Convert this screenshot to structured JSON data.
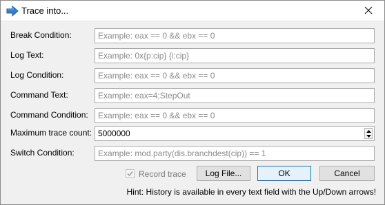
{
  "window": {
    "title": "Trace into...",
    "close_label": "×"
  },
  "fields": {
    "break_condition": {
      "label": "Break Condition:",
      "value": "",
      "placeholder": "Example: eax == 0 && ebx == 0"
    },
    "log_text": {
      "label": "Log Text:",
      "value": "",
      "placeholder": "Example: 0x{p:cip} {i:cip}"
    },
    "log_condition": {
      "label": "Log Condition:",
      "value": "",
      "placeholder": "Example: eax == 0 && ebx == 0"
    },
    "command_text": {
      "label": "Command Text:",
      "value": "",
      "placeholder": "Example: eax=4;StepOut"
    },
    "command_condition": {
      "label": "Command Condition:",
      "value": "",
      "placeholder": "Example: eax == 0 && ebx == 0"
    },
    "max_trace_count": {
      "label": "Maximum trace count:",
      "value": "5000000"
    },
    "switch_condition": {
      "label": "Switch Condition:",
      "value": "",
      "placeholder": "Example: mod.party(dis.branchdest(cip)) == 1"
    }
  },
  "record_trace": {
    "label": "Record trace",
    "checked": true,
    "enabled": false
  },
  "buttons": {
    "log_file": "Log File...",
    "ok": "OK",
    "cancel": "Cancel"
  },
  "hint": "Hint: History is available in every text field with the Up/Down arrows!",
  "colors": {
    "accent": "#0078d7",
    "icon_blue": "#2f7fd6"
  }
}
